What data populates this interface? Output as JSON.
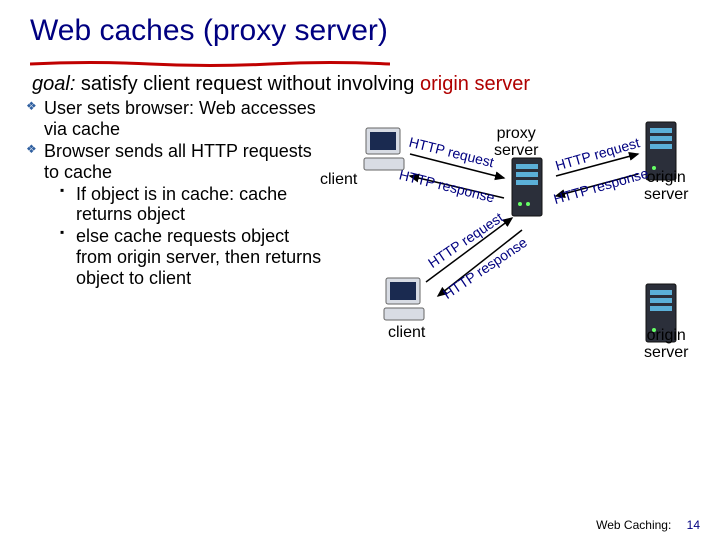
{
  "title": "Web caches (proxy server)",
  "goal": {
    "label": "goal:",
    "text": " satisfy client request without involving ",
    "origin": "origin server"
  },
  "bullets": {
    "b1": "User sets browser: Web accesses via  cache",
    "b2": "Browser sends all HTTP requests to cache",
    "b2a": "If object is in cache: cache returns object",
    "b2b": "else cache requests object from origin server, then returns object to client"
  },
  "diagram": {
    "proxy": "proxy\nserver",
    "client": "client",
    "origin": "origin\nserver",
    "req": "HTTP request",
    "resp": "HTTP response"
  },
  "footer": {
    "text": "Web Caching:",
    "page": "14"
  }
}
